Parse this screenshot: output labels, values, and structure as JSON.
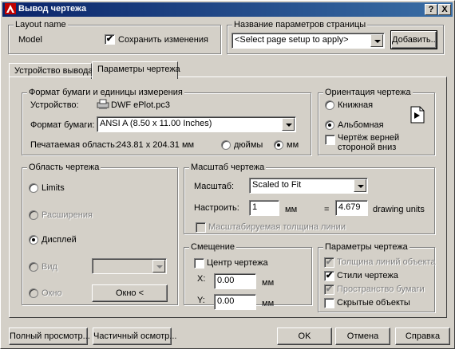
{
  "title": "Вывод чертежа",
  "title_buttons": {
    "help": "?",
    "close": "X"
  },
  "layout": {
    "group_label": "Layout name",
    "name": "Model",
    "save_changes_label": "Сохранить изменения",
    "save_changes_checked": true
  },
  "page_setup": {
    "group_label": "Название параметров страницы",
    "value": "<Select page setup to apply>",
    "add_button": "Добавить..."
  },
  "tabs": [
    {
      "label": "Устройство вывода",
      "active": false
    },
    {
      "label": "Параметры чертежа",
      "active": true
    }
  ],
  "paper": {
    "group_label": "Формат бумаги и единицы измерения",
    "device_label": "Устройство:",
    "device_value": "DWF ePlot.pc3",
    "paper_label": "Формат бумаги:",
    "paper_value": "ANSI A (8.50 x 11.00 Inches)",
    "printable_label": "Печатаемая область:",
    "printable_value": "243.81 x 204.31 мм",
    "inches_label": "дюймы",
    "mm_label": "мм",
    "units_selected": "mm"
  },
  "orientation": {
    "group_label": "Ориентация чертежа",
    "portrait_label": "Книжная",
    "landscape_label": "Альбомная",
    "selected": "landscape",
    "upside_down_label_1": "Чертёж верней",
    "upside_down_label_2": "стороной вниз",
    "upside_down_checked": false,
    "icon": "landscape-orientation-icon"
  },
  "area": {
    "group_label": "Область чертежа",
    "limits_label": "Limits",
    "extents_label": "Расширения",
    "display_label": "Дисплей",
    "view_label": "Вид",
    "window_label": "Окно",
    "window_button": "Окно <",
    "selected": "display"
  },
  "scale": {
    "group_label": "Масштаб чертежа",
    "scale_label": "Масштаб:",
    "scale_value": "Scaled to Fit",
    "custom_label": "Настроить:",
    "custom_value_1": "1",
    "unit_1": "мм",
    "equals": "=",
    "custom_value_2": "4.679",
    "unit_2": "drawing units",
    "scale_lineweights_label": "Масштабируемая толщина линии",
    "scale_lineweights_checked": false
  },
  "offset": {
    "group_label": "Смещение",
    "center_label": "Центр чертежа",
    "center_checked": false,
    "x_label": "X:",
    "x_value": "0.00",
    "x_unit": "мм",
    "y_label": "Y:",
    "y_value": "0.00",
    "y_unit": "мм"
  },
  "options": {
    "group_label": "Параметры чертежа",
    "lineweights_label": "Толщина линий объекта",
    "lineweights_checked": true,
    "styles_label": "Стили чертежа",
    "styles_checked": true,
    "paperspace_label": "Пространство бумаги",
    "paperspace_checked": true,
    "hide_label": "Скрытые объекты",
    "hide_checked": false
  },
  "footer": {
    "full_preview": "Полный просмотр...",
    "partial_preview": "Частичный осмотр...",
    "ok": "OK",
    "cancel": "Отмена",
    "help": "Справка"
  }
}
